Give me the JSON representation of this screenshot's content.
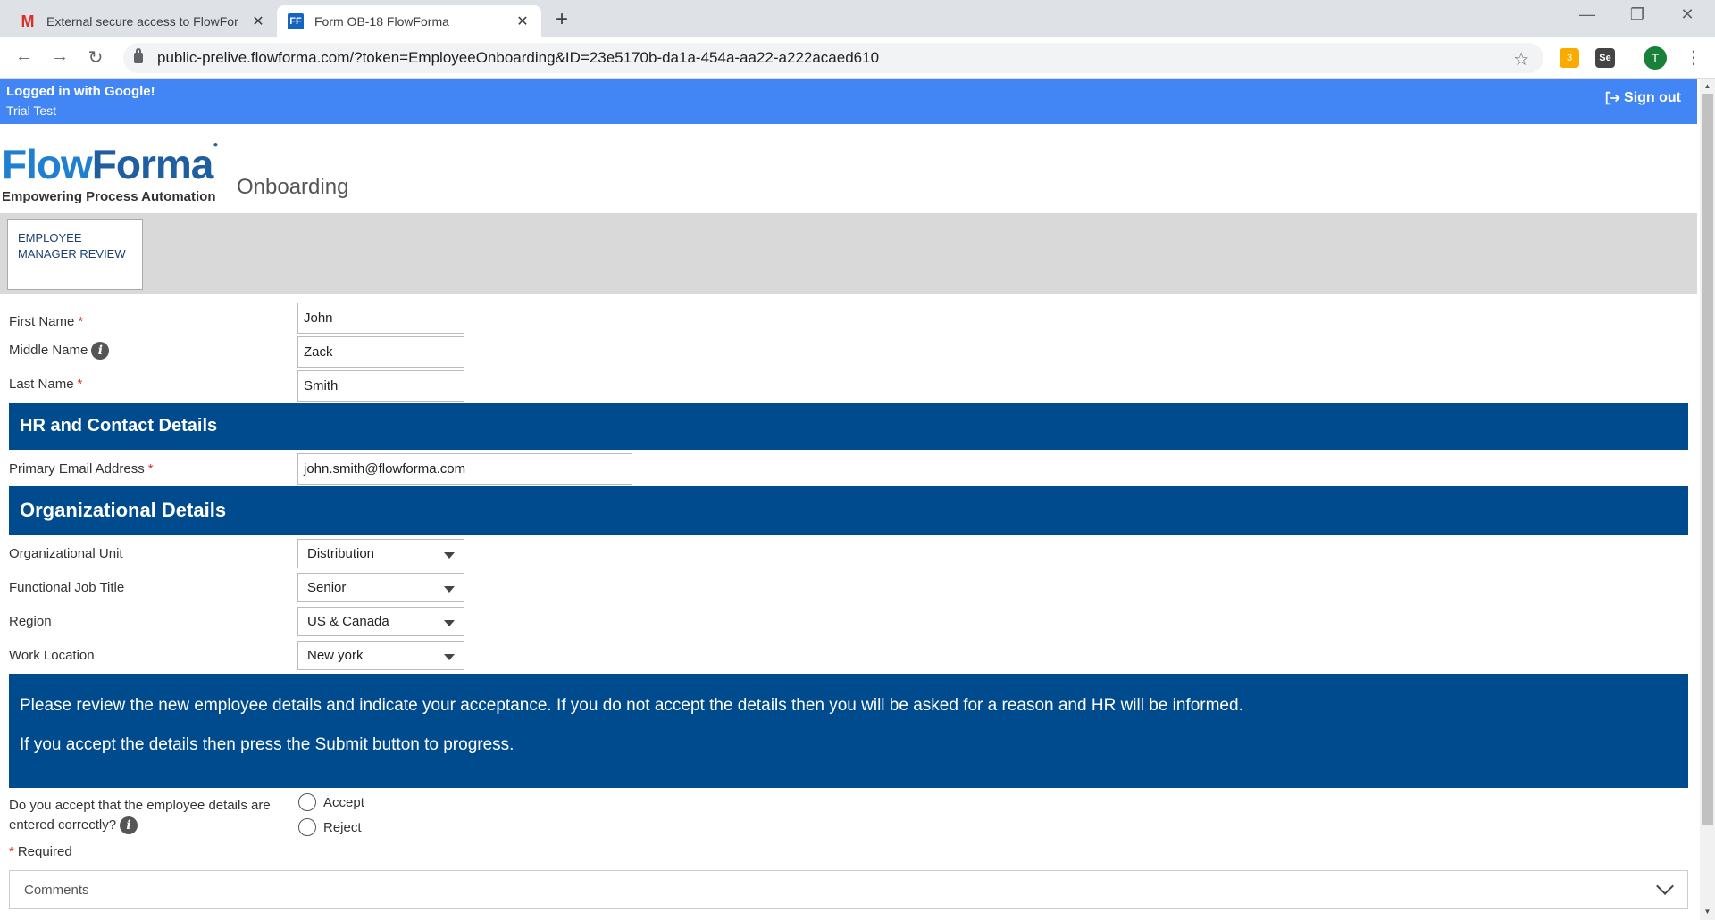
{
  "browser": {
    "tabs": [
      {
        "title": "External secure access to FlowFor",
        "favicon": "gmail-icon",
        "active": false
      },
      {
        "title": "Form OB-18 FlowForma",
        "favicon": "flowforma-icon",
        "active": true
      }
    ],
    "new_tab_symbol": "+",
    "url": "public-prelive.flowforma.com/?token=EmployeeOnboarding&ID=23e5170b-da1a-454a-aa22-a222acaed610",
    "avatar_letter": "T",
    "extension_badge": "3",
    "extension_se": "Se"
  },
  "header": {
    "logged_in": "Logged in with Google!",
    "user": "Trial Test",
    "sign_out": "Sign out"
  },
  "brand": {
    "logo_flow": "Flow",
    "logo_forma": "Forma",
    "tagline": "Empowering Process Automation",
    "app_title": "Onboarding"
  },
  "stage": {
    "line1": "EMPLOYEE",
    "line2": "MANAGER REVIEW"
  },
  "fields": {
    "first_name": {
      "label": "First Name",
      "value": "John",
      "required": true
    },
    "middle_name": {
      "label": "Middle Name",
      "value": "Zack"
    },
    "last_name": {
      "label": "Last Name",
      "value": "Smith",
      "required": true
    },
    "email": {
      "label": "Primary Email Address",
      "value": "john.smith@flowforma.com",
      "required": true
    },
    "org_unit": {
      "label": "Organizational Unit",
      "value": "Distribution"
    },
    "job_title": {
      "label": "Functional Job Title",
      "value": "Senior"
    },
    "region": {
      "label": "Region",
      "value": "US & Canada"
    },
    "work_location": {
      "label": "Work Location",
      "value": "New york"
    }
  },
  "sections": {
    "hr": "HR and Contact Details",
    "org": "Organizational Details"
  },
  "notice": {
    "line1": "Please review the new employee details and indicate your acceptance. If you do not accept the details then you will be asked for a reason and HR will be informed.",
    "line2": "If you accept the details then press the Submit button to progress."
  },
  "acceptance": {
    "question_line1": "Do you accept that the employee details are",
    "question_line2": "entered correctly?",
    "options": [
      "Accept",
      "Reject"
    ],
    "required_note": "Required",
    "required_mark": "*"
  },
  "comments_label": "Comments",
  "colors": {
    "topbar": "#4285f4",
    "section": "#004b8d",
    "required": "#d93025"
  }
}
